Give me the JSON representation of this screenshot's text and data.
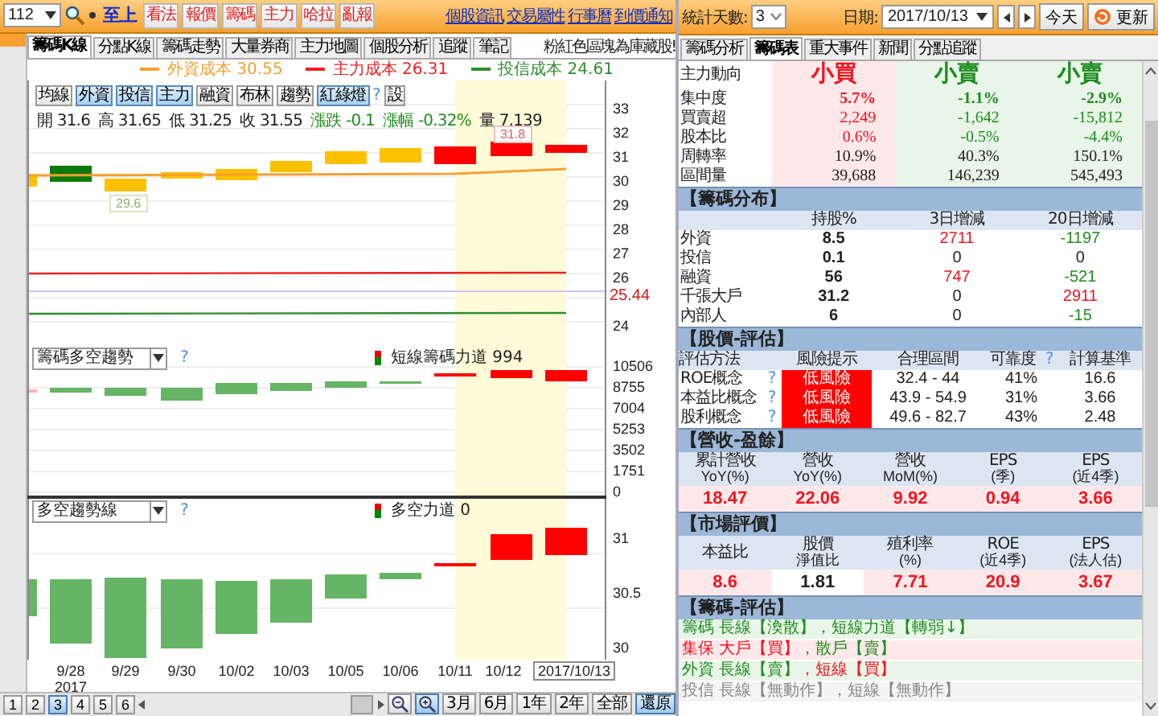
{
  "left_toolbar": {
    "stock_code": "112",
    "stock_name": "至上",
    "buttons": [
      "看法",
      "報價",
      "籌碼",
      "主力",
      "哈拉",
      "亂報"
    ],
    "links": [
      "個股資訊",
      "交易屬性",
      "行事曆",
      "到價通知"
    ]
  },
  "chart_tabs": [
    {
      "label": "籌碼K線",
      "selected": true
    },
    {
      "label": "分點K線",
      "selected": false
    },
    {
      "label": "籌碼走勢",
      "selected": false
    },
    {
      "label": "大量券商",
      "selected": false
    },
    {
      "label": "主力地圖",
      "selected": false
    },
    {
      "label": "個股分析",
      "selected": false
    },
    {
      "label": "追蹤",
      "selected": false
    },
    {
      "label": "筆記",
      "selected": false
    }
  ],
  "chart_note": "粉紅色區塊為庫藏股!",
  "cost_legend": [
    {
      "label": "外資成本 30.55",
      "color": "#f5a030"
    },
    {
      "label": "主力成本 26.31",
      "color": "#ee2020"
    },
    {
      "label": "投信成本 24.61",
      "color": "#2e8b2e"
    }
  ],
  "indicator_buttons": [
    {
      "label": "均線",
      "selected": false
    },
    {
      "label": "外資",
      "selected": true
    },
    {
      "label": "投信",
      "selected": true
    },
    {
      "label": "主力",
      "selected": true
    },
    {
      "label": "融資",
      "selected": false
    },
    {
      "label": "布林",
      "selected": false
    },
    {
      "label": "趨勢",
      "selected": false
    },
    {
      "label": "紅綠燈",
      "selected": true
    }
  ],
  "indicator_help": "?",
  "settings_button": "設",
  "quote": [
    {
      "text": "開 31.6",
      "kind": "plain"
    },
    {
      "text": "高 31.65",
      "kind": "plain"
    },
    {
      "text": "低 31.25",
      "kind": "plain"
    },
    {
      "text": "收 31.55",
      "kind": "plain"
    },
    {
      "text": "漲跌 -0.1",
      "kind": "change"
    },
    {
      "text": "漲幅 -0.32%",
      "kind": "change"
    },
    {
      "text": "量 7,139",
      "kind": "plain"
    }
  ],
  "high_tag": "31.8",
  "low_tag": "29.6",
  "price_axis": [
    "33",
    "32",
    "31",
    "30",
    "29",
    "28",
    "27",
    "26",
    "24"
  ],
  "cost_marker": "25.44",
  "trend_panel": {
    "selector": "籌碼多空趨勢",
    "help": "?",
    "legend": "短線籌碼力道 994",
    "axis": [
      "10506",
      "8755",
      "7004",
      "5253",
      "3502",
      "1751",
      "0"
    ]
  },
  "force_panel": {
    "selector": "多空趨勢線",
    "help": "?",
    "legend": "多空力道 0",
    "axis": [
      "31",
      "30.5",
      "30"
    ]
  },
  "dates": [
    {
      "label": "9/28",
      "sub": "2017",
      "selected": false
    },
    {
      "label": "9/29",
      "selected": false
    },
    {
      "label": "9/30",
      "selected": false
    },
    {
      "label": "10/02",
      "selected": false
    },
    {
      "label": "10/03",
      "selected": false
    },
    {
      "label": "10/05",
      "selected": false
    },
    {
      "label": "10/06",
      "selected": false
    },
    {
      "label": "10/11",
      "selected": false
    },
    {
      "label": "10/12",
      "selected": false
    },
    {
      "label": "2017/10/13",
      "selected": true
    }
  ],
  "pages": [
    {
      "label": "1",
      "selected": false
    },
    {
      "label": "2",
      "selected": false
    },
    {
      "label": "3",
      "selected": true
    },
    {
      "label": "4",
      "selected": false
    },
    {
      "label": "5",
      "selected": false
    },
    {
      "label": "6",
      "selected": false
    }
  ],
  "zoom_buttons": [
    {
      "kind": "out",
      "selected": false
    },
    {
      "kind": "in",
      "selected": true
    }
  ],
  "ranges": [
    {
      "label": "3月",
      "selected": false
    },
    {
      "label": "6月",
      "selected": false
    },
    {
      "label": "1年",
      "selected": false
    },
    {
      "label": "2年",
      "selected": false
    },
    {
      "label": "全部",
      "selected": false
    },
    {
      "label": "還原",
      "selected": true
    }
  ],
  "stats_bar": {
    "days_label": "統計天數:",
    "days_value": "3",
    "date_label": "日期:",
    "date_value": "2017/10/13",
    "today_button": "今天",
    "refresh_button": "更新"
  },
  "info_tabs": [
    {
      "label": "籌碼分析",
      "selected": false
    },
    {
      "label": "籌碼表",
      "selected": true
    },
    {
      "label": "重大事件",
      "selected": false
    },
    {
      "label": "新聞",
      "selected": false
    },
    {
      "label": "分點追蹤",
      "selected": false
    }
  ],
  "flow_table": {
    "columns": [
      {
        "color": "#ffe8ea"
      },
      {
        "color": "#e8f5e8"
      },
      {
        "color": "#e8f5e8"
      }
    ],
    "rows": [
      {
        "label": "主力動向",
        "cells": [
          {
            "text": "小買",
            "color": "#f0141e"
          },
          {
            "text": "小賣",
            "color": "#1e8c1e"
          },
          {
            "text": "小賣",
            "color": "#1e8c1e"
          }
        ]
      },
      {
        "label": "集中度",
        "cells": [
          {
            "text": "5.7%",
            "color": "#f0141e"
          },
          {
            "text": "-1.1%",
            "color": "#1e8c1e"
          },
          {
            "text": "-2.9%",
            "color": "#1e8c1e"
          }
        ]
      },
      {
        "label": "買賣超",
        "cells": [
          {
            "text": "2,249",
            "color": "#f0141e"
          },
          {
            "text": "-1,642",
            "color": "#1e8c1e"
          },
          {
            "text": "-15,812",
            "color": "#1e8c1e"
          }
        ]
      },
      {
        "label": "股本比",
        "cells": [
          {
            "text": "0.6%",
            "color": "#f0141e"
          },
          {
            "text": "-0.5%",
            "color": "#1e8c1e"
          },
          {
            "text": "-4.4%",
            "color": "#1e8c1e"
          }
        ]
      },
      {
        "label": "周轉率",
        "cells": [
          {
            "text": "10.9%",
            "color": "#222222"
          },
          {
            "text": "40.3%",
            "color": "#222222"
          },
          {
            "text": "150.1%",
            "color": "#222222"
          }
        ]
      },
      {
        "label": "區間量",
        "cells": [
          {
            "text": "39,688",
            "color": "#222222"
          },
          {
            "text": "146,239",
            "color": "#222222"
          },
          {
            "text": "545,493",
            "color": "#222222"
          }
        ]
      }
    ]
  },
  "distribution": {
    "title": "【籌碼分布】",
    "columns": [
      "持股%",
      "3日增減",
      "20日增減"
    ],
    "rows": [
      {
        "label": "外資",
        "cells": [
          {
            "text": "8.5",
            "color": "#222222"
          },
          {
            "text": "2711",
            "color": "#f0141e"
          },
          {
            "text": "-1197",
            "color": "#1e8c1e"
          }
        ]
      },
      {
        "label": "投信",
        "cells": [
          {
            "text": "0.1",
            "color": "#222222"
          },
          {
            "text": "0",
            "color": "#222222"
          },
          {
            "text": "0",
            "color": "#222222"
          }
        ]
      },
      {
        "label": "融資",
        "cells": [
          {
            "text": "56",
            "color": "#222222"
          },
          {
            "text": "747",
            "color": "#f0141e"
          },
          {
            "text": "-521",
            "color": "#1e8c1e"
          }
        ]
      },
      {
        "label": "千張大戶",
        "cells": [
          {
            "text": "31.2",
            "color": "#222222"
          },
          {
            "text": "0",
            "color": "#222222"
          },
          {
            "text": "2911",
            "color": "#f0141e"
          }
        ]
      },
      {
        "label": "內部人",
        "cells": [
          {
            "text": "6",
            "color": "#222222"
          },
          {
            "text": "0",
            "color": "#222222"
          },
          {
            "text": "-15",
            "color": "#1e8c1e"
          }
        ]
      }
    ]
  },
  "valuation": {
    "title": "【股價-評估】",
    "columns": [
      "評估方法",
      "風險提示",
      "合理區間",
      "可靠度",
      "計算基準"
    ],
    "reliability_help": "?",
    "rows": [
      {
        "method": "ROE概念",
        "help": "?",
        "risk": "低風險",
        "range": "32.4 - 44",
        "reliability": "41%",
        "basis": "16.6"
      },
      {
        "method": "本益比概念",
        "help": "?",
        "risk": "低風險",
        "range": "43.9 - 54.9",
        "reliability": "31%",
        "basis": "3.66"
      },
      {
        "method": "股利概念",
        "help": "?",
        "risk": "低風險",
        "range": "49.6 - 82.7",
        "reliability": "43%",
        "basis": "2.48"
      }
    ]
  },
  "revenue": {
    "title": "【營收-盈餘】",
    "columns": [
      [
        "累計營收",
        "YoY(%)"
      ],
      [
        "營收",
        "YoY(%)"
      ],
      [
        "營收",
        "MoM(%)"
      ],
      [
        "EPS",
        "(季)"
      ],
      [
        "EPS",
        "(近4季)"
      ]
    ],
    "values": [
      {
        "text": "18.47",
        "highlighted": false
      },
      {
        "text": "22.06",
        "highlighted": false
      },
      {
        "text": "9.92",
        "highlighted": false
      },
      {
        "text": "0.94",
        "highlighted": false
      },
      {
        "text": "3.66",
        "highlighted": false
      }
    ]
  },
  "market": {
    "title": "【市場評價】",
    "columns": [
      [
        "本益比"
      ],
      [
        "股價",
        "淨值比"
      ],
      [
        "殖利率",
        "(%)"
      ],
      [
        "ROE",
        "(近4季)"
      ],
      [
        "EPS",
        "(法人估)"
      ]
    ],
    "values": [
      {
        "text": "8.6",
        "highlighted": false
      },
      {
        "text": "1.81",
        "highlighted": true
      },
      {
        "text": "7.71",
        "highlighted": false
      },
      {
        "text": "20.9",
        "highlighted": false
      },
      {
        "text": "3.67",
        "highlighted": false
      }
    ]
  },
  "signals": {
    "title": "【籌碼-評估】",
    "rows": [
      {
        "color": "#e8f5e8",
        "parts": [
          {
            "text": "籌碼 長線【渙散】",
            "color": "#1e8c1e"
          },
          {
            "text": "，短線力道【轉弱↓】",
            "color": "#1e8c1e"
          }
        ]
      },
      {
        "color": "#ffe8ea",
        "parts": [
          {
            "text": "集保 大戶【買】",
            "color": "#f0141e"
          },
          {
            "text": "，散戶【賣】",
            "color": "#1e8c1e"
          }
        ]
      },
      {
        "color": "#e8f5e8",
        "parts": [
          {
            "text": "外資 長線【賣】",
            "color": "#1e8c1e"
          },
          {
            "text": "，短線【買】",
            "color": "#f0141e"
          }
        ]
      },
      {
        "color": "#f4f4f4",
        "parts": [
          {
            "text": "投信 長線【無動作】",
            "color": "#888888"
          },
          {
            "text": "，短線【無動作】",
            "color": "#888888"
          }
        ]
      }
    ]
  }
}
